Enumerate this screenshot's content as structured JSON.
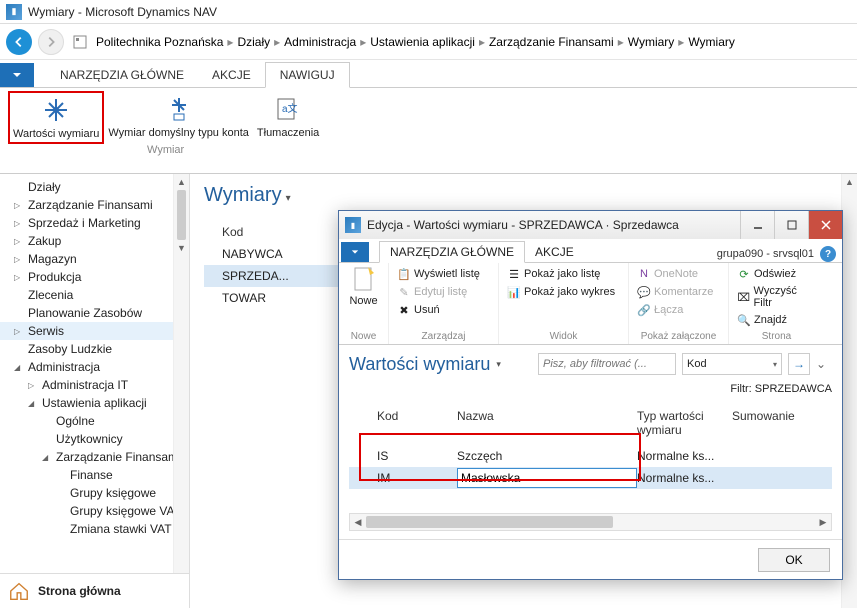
{
  "window": {
    "title": "Wymiary - Microsoft Dynamics NAV"
  },
  "breadcrumbs": {
    "items": [
      "Politechnika Poznańska",
      "Działy",
      "Administracja",
      "Ustawienia aplikacji",
      "Zarządzanie Finansami",
      "Wymiary",
      "Wymiary"
    ]
  },
  "ribbon": {
    "tabs": {
      "home": "NARZĘDZIA GŁÓWNE",
      "actions": "AKCJE",
      "navigate": "NAWIGUJ"
    },
    "wymiar": {
      "wartosci": "Wartości wymiaru",
      "domyslny": "Wymiar domyślny typu konta",
      "tlumaczenia": "Tłumaczenia",
      "group": "Wymiar"
    }
  },
  "tree": {
    "items": [
      {
        "l": "Działy",
        "lv": 1,
        "arr": ""
      },
      {
        "l": "Zarządzanie Finansami",
        "lv": 1,
        "arr": "▷"
      },
      {
        "l": "Sprzedaż i Marketing",
        "lv": 1,
        "arr": "▷"
      },
      {
        "l": "Zakup",
        "lv": 1,
        "arr": "▷"
      },
      {
        "l": "Magazyn",
        "lv": 1,
        "arr": "▷"
      },
      {
        "l": "Produkcja",
        "lv": 1,
        "arr": "▷"
      },
      {
        "l": "Zlecenia",
        "lv": 1,
        "arr": ""
      },
      {
        "l": "Planowanie Zasobów",
        "lv": 1,
        "arr": ""
      },
      {
        "l": "Serwis",
        "lv": 1,
        "arr": "▷",
        "sel": true
      },
      {
        "l": "Zasoby Ludzkie",
        "lv": 1,
        "arr": ""
      },
      {
        "l": "Administracja",
        "lv": 1,
        "arr": "◢"
      },
      {
        "l": "Administracja IT",
        "lv": 2,
        "arr": "▷"
      },
      {
        "l": "Ustawienia aplikacji",
        "lv": 2,
        "arr": "◢"
      },
      {
        "l": "Ogólne",
        "lv": 3,
        "arr": ""
      },
      {
        "l": "Użytkownicy",
        "lv": 3,
        "arr": ""
      },
      {
        "l": "Zarządzanie Finansami",
        "lv": 3,
        "arr": "◢"
      },
      {
        "l": "Finanse",
        "lv": 4,
        "arr": ""
      },
      {
        "l": "Grupy księgowe",
        "lv": 4,
        "arr": ""
      },
      {
        "l": "Grupy księgowe VAT",
        "lv": 4,
        "arr": ""
      },
      {
        "l": "Zmiana stawki VAT",
        "lv": 4,
        "arr": ""
      }
    ],
    "home": "Strona główna"
  },
  "content": {
    "title": "Wymiary",
    "col": "Kod",
    "rows": [
      "NABYWCA",
      "SPRZEDA...",
      "TOWAR"
    ],
    "sel": 1
  },
  "dialog": {
    "title": "Edycja - Wartości wymiaru - SPRZEDAWCA · Sprzedawca",
    "user": "grupa090 - srvsql01",
    "tabs": {
      "home": "NARZĘDZIA GŁÓWNE",
      "actions": "AKCJE"
    },
    "ribbon": {
      "nowe": "Nowe",
      "noweGrp": "Nowe",
      "wyswietl": "Wyświetl listę",
      "edytuj": "Edytuj listę",
      "usun": "Usuń",
      "zarzadzaj": "Zarządzaj",
      "pokazLista": "Pokaż jako listę",
      "pokazWykres": "Pokaż jako wykres",
      "widok": "Widok",
      "onenote": "OneNote",
      "komentarze": "Komentarze",
      "lacza": "Łącza",
      "pokazZal": "Pokaż załączone",
      "odswiez": "Odśwież",
      "wyczysc": "Wyczyść Filtr",
      "znajdz": "Znajdź",
      "strona": "Strona"
    },
    "heading": "Wartości wymiaru",
    "filterPlaceholder": "Pisz, aby filtrować (...",
    "filterField": "Kod",
    "filterLabel": "Filtr: SPRZEDAWCA",
    "cols": {
      "kod": "Kod",
      "nazwa": "Nazwa",
      "typ": "Typ wartości wymiaru",
      "sum": "Sumowanie"
    },
    "rows": [
      {
        "kod": "IS",
        "nazwa": "Szczęch",
        "typ": "Normalne ks..."
      },
      {
        "kod": "IM",
        "nazwa": "Masłowska",
        "typ": "Normalne ks...",
        "sel": true,
        "edit": true
      }
    ],
    "ok": "OK"
  }
}
